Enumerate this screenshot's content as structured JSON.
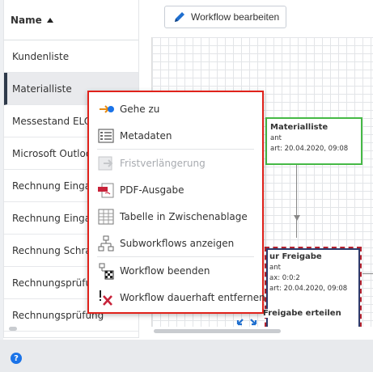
{
  "sidebar": {
    "header": "Name",
    "items": [
      {
        "label": "Kundenliste"
      },
      {
        "label": "Materialliste"
      },
      {
        "label": "Messestand ELO (..."
      },
      {
        "label": "Microsoft Outlook"
      },
      {
        "label": "Rechnung Eingang"
      },
      {
        "label": "Rechnung Eingang"
      },
      {
        "label": "Rechnung Schranz"
      },
      {
        "label": "Rechnungsprüfung"
      },
      {
        "label": "Rechnungsprüfung"
      }
    ],
    "selected_index": 1
  },
  "toolbar": {
    "edit_workflow_label": "Workflow bearbeiten"
  },
  "canvas": {
    "node_a": {
      "title": "Materialliste",
      "line1": "ant",
      "line2": "art: 20.04.2020, 09:08"
    },
    "node_b": {
      "title": "ur Freigabe",
      "line1": "ant",
      "line2": "ax: 0:0:2",
      "line3": "art: 20.04.2020, 09:08"
    },
    "node_c": {
      "title": "Freigabe erteilen"
    }
  },
  "context_menu": {
    "items": [
      {
        "label": "Gehe zu",
        "icon": "goto-icon",
        "enabled": true
      },
      {
        "label": "Metadaten",
        "icon": "metadata-icon",
        "enabled": true
      },
      {
        "label": "Fristverlängerung",
        "icon": "deadline-extension-icon",
        "enabled": false
      },
      {
        "label": "PDF-Ausgabe",
        "icon": "pdf-icon",
        "enabled": true
      },
      {
        "label": "Tabelle in Zwischenablage",
        "icon": "table-icon",
        "enabled": true
      },
      {
        "label": "Subworkflows anzeigen",
        "icon": "subworkflow-icon",
        "enabled": true
      },
      {
        "label": "Workflow beenden",
        "icon": "workflow-end-icon",
        "enabled": true
      },
      {
        "label": "Workflow dauerhaft entfernen",
        "icon": "workflow-delete-icon",
        "enabled": true
      }
    ]
  },
  "footer": {
    "help_glyph": "?"
  },
  "colors": {
    "menu_border": "#e0221b",
    "accent_blue": "#1a73e8",
    "node_green": "#46b946",
    "node_red": "#b5232f"
  }
}
